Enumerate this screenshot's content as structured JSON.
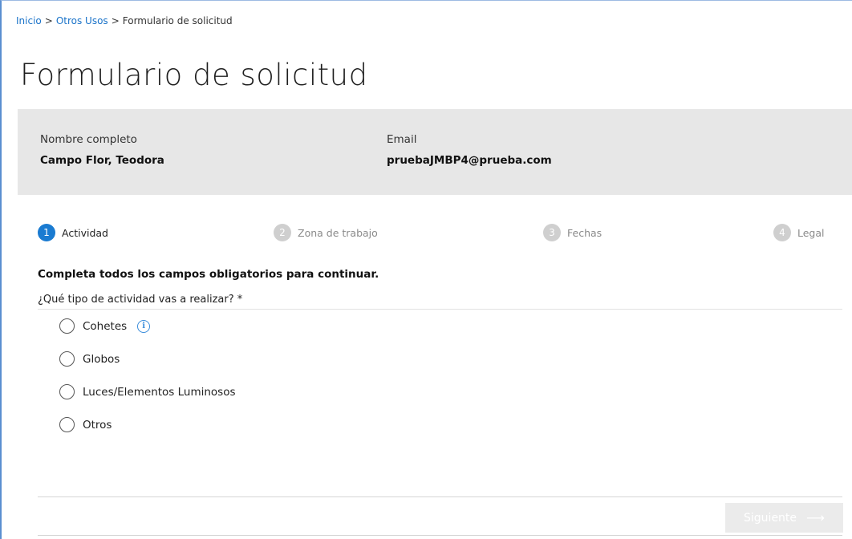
{
  "breadcrumb": {
    "home": "Inicio",
    "separator1": ">",
    "section": "Otros Usos",
    "separator2": ">",
    "current": "Formulario de solicitud"
  },
  "page_title": "Formulario de solicitud",
  "applicant": {
    "name_label": "Nombre completo",
    "name_value": "Campo Flor, Teodora",
    "email_label": "Email",
    "email_value": "pruebaJMBP4@prueba.com"
  },
  "steps": [
    {
      "number": "1",
      "label": "Actividad",
      "active": true
    },
    {
      "number": "2",
      "label": "Zona de trabajo",
      "active": false
    },
    {
      "number": "3",
      "label": "Fechas",
      "active": false
    },
    {
      "number": "4",
      "label": "Legal",
      "active": false
    }
  ],
  "form": {
    "instructions": "Completa todos los campos obligatorios para continuar.",
    "question": "¿Qué tipo de actividad vas a realizar? *",
    "options": [
      {
        "label": "Cohetes",
        "has_info": true,
        "info_glyph": "i"
      },
      {
        "label": "Globos",
        "has_info": false
      },
      {
        "label": "Luces/Elementos Luminosos",
        "has_info": false
      },
      {
        "label": "Otros",
        "has_info": false
      }
    ]
  },
  "footer": {
    "next_label": "Siguiente",
    "next_arrow": "⟶",
    "next_enabled": false
  },
  "colors": {
    "accent": "#1a7bd1",
    "link": "#1a73c9",
    "panel": "#e7e7e7",
    "inactive_step": "#cfcfcf",
    "disabled_button": "#ebebeb"
  },
  "icons": {
    "info": "info-circle-icon",
    "radio": "radio-unchecked-icon",
    "next_arrow": "arrow-right-icon"
  }
}
